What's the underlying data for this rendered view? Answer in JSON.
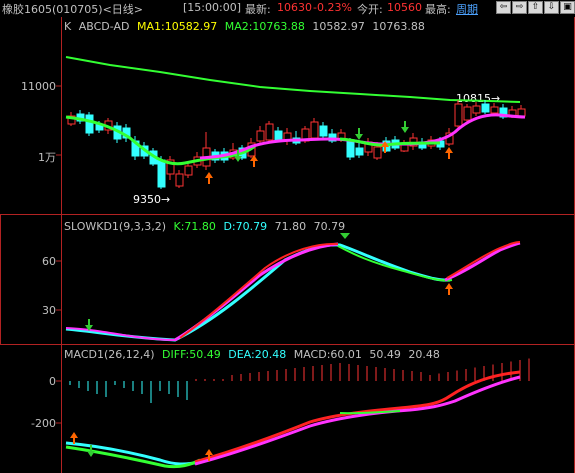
{
  "topbar": {
    "symbol": "橡胶1605",
    "code": "(010705)",
    "period": "<日线>",
    "time": "[15:00:00]",
    "latest_label": "最新:",
    "latest_value": "10630",
    "change_pct": "-0.23%",
    "open_label": "今开:",
    "open_value": "10560",
    "high_label": "最高:",
    "period_link": "周期",
    "nav_buttons": [
      "⇦",
      "⇨",
      "⇧",
      "⇩",
      "▣"
    ]
  },
  "main_panel": {
    "indicator": "K",
    "name": "ABCD-AD",
    "ma1_label": "MA1:10582.97",
    "ma2_label": "MA2:10763.88",
    "v1": "10582.97",
    "v2": "10763.88",
    "y_ticks": [
      "11000",
      "1万"
    ],
    "low_annotation": "9350→",
    "high_annotation": "10815→"
  },
  "kd_panel": {
    "title": "SLOWKD1(9,3,3,2)",
    "k_label": "K:71.80",
    "d_label": "D:70.79",
    "v1": "71.80",
    "v2": "70.79",
    "y_ticks": [
      "60",
      "30"
    ]
  },
  "macd_panel": {
    "title": "MACD1(26,12,4)",
    "diff_label": "DIFF:50.49",
    "dea_label": "DEA:20.48",
    "macd_label": "MACD:60.01",
    "v1": "50.49",
    "v2": "20.48",
    "y_ticks": [
      "0",
      "-200"
    ]
  },
  "colors": {
    "up": "#ff3333",
    "down": "#33ffff",
    "ma_green": "#33ff33",
    "magenta": "#ff33ff",
    "frame": "#b22222"
  }
}
